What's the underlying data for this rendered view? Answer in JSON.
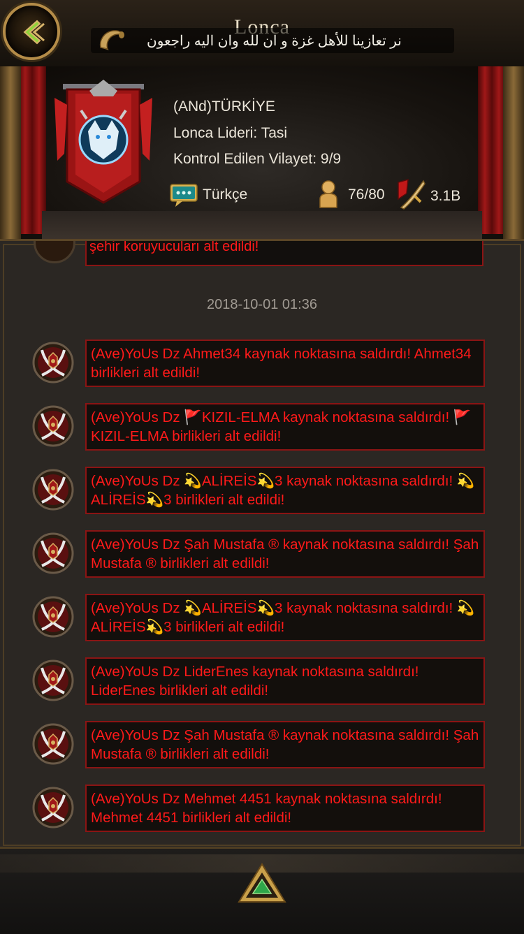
{
  "header": {
    "title": "Lonca",
    "ticker_text": "نر تعازينا للأهل غزة و ان لله وان اليه راجعون"
  },
  "guild": {
    "name": "(ANd)TÜRKİYE",
    "leader": "Lonca Lideri: Tasi",
    "province": "Kontrol Edilen Vilayet: 9/9",
    "language": "Türkçe",
    "members": "76/80",
    "power": "3.1B"
  },
  "log": {
    "partial_text": "şehir koruyucuları alt edildi!",
    "timestamp": "2018-10-01 01:36",
    "entries": [
      "(Ave)YoUs Dz Ahmet34 kaynak noktasına saldırdı! Ahmet34 birlikleri alt edildi!",
      "(Ave)YoUs Dz 🚩KIZIL-ELMA kaynak noktasına saldırdı! 🚩KIZIL-ELMA birlikleri alt edildi!",
      "(Ave)YoUs Dz 💫ALİREİS💫3 kaynak noktasına saldırdı! 💫ALİREİS💫3 birlikleri alt edildi!",
      "(Ave)YoUs Dz Şah Mustafa ® kaynak noktasına saldırdı! Şah Mustafa ® birlikleri alt edildi!",
      "(Ave)YoUs Dz 💫ALİREİS💫3 kaynak noktasına saldırdı! 💫ALİREİS💫3 birlikleri alt edildi!",
      "(Ave)YoUs Dz LiderEnes kaynak noktasına saldırdı! LiderEnes birlikleri alt edildi!",
      "(Ave)YoUs Dz Şah Mustafa ® kaynak noktasına saldırdı! Şah Mustafa ® birlikleri alt edildi!",
      "(Ave)YoUs Dz Mehmet 4451 kaynak noktasına saldırdı! Mehmet 4451 birlikleri alt edildi!"
    ]
  }
}
